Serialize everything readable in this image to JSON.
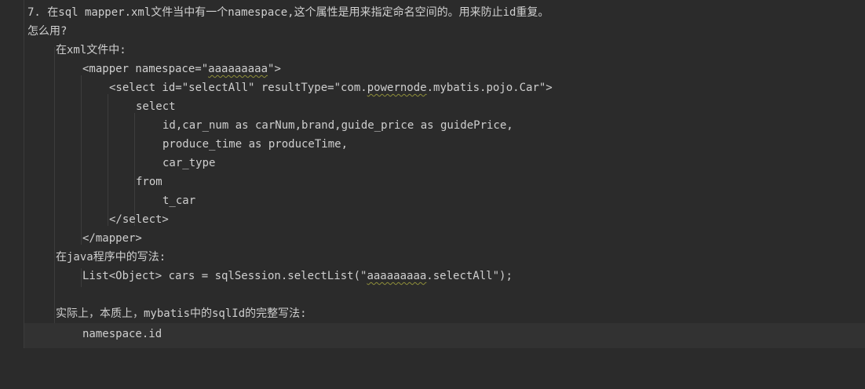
{
  "lines": {
    "l1": "7. 在sql mapper.xml文件当中有一个namespace,这个属性是用来指定命名空间的。用来防止id重复。",
    "l2": "怎么用?",
    "l3": "在xml文件中:",
    "l4_a": "<mapper namespace=\"",
    "l4_b": "aaaaaaaaa",
    "l4_c": "\">",
    "l5_a": "<select id=\"selectAll\" resultType=\"com.",
    "l5_b": "powernode",
    "l5_c": ".mybatis.pojo.Car\">",
    "l6": "select",
    "l7": "id,car_num as carNum,brand,guide_price as guidePrice,",
    "l8": "produce_time as produceTime,",
    "l9": "car_type",
    "l10": "from",
    "l11": "t_car",
    "l12": "</select>",
    "l13": "</mapper>",
    "l14": "在java程序中的写法:",
    "l15_a": "List<Object> cars = sqlSession.selectList(\"",
    "l15_b": "aaaaaaaaa",
    "l15_c": ".selectAll\");",
    "l16": "",
    "l17": "实际上，本质上，mybatis中的sqlId的完整写法:",
    "l18": "namespace.id"
  }
}
